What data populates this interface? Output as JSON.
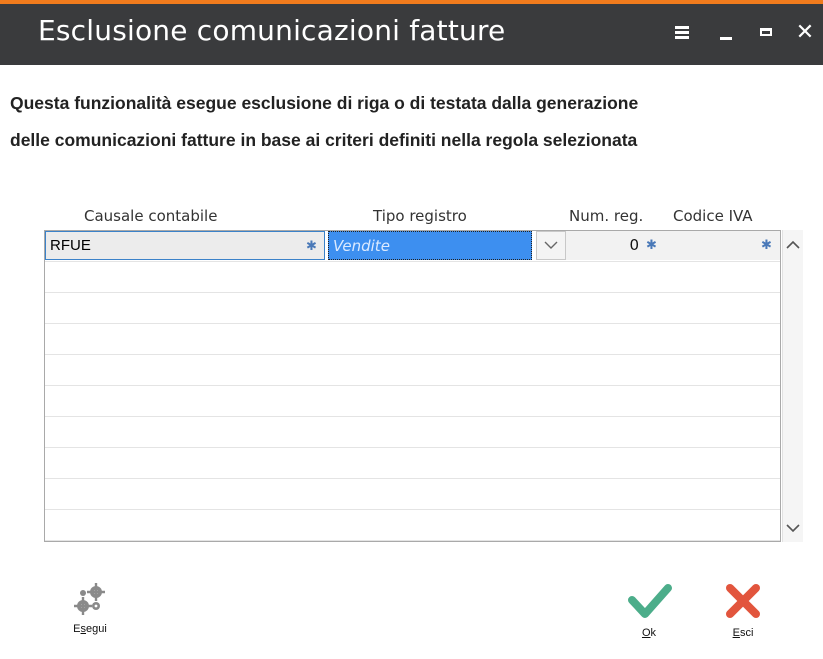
{
  "window": {
    "title": "Esclusione comunicazioni fatture"
  },
  "description": {
    "line1": "Questa funzionalità esegue esclusione di riga o di testata dalla generazione",
    "line2": "delle comunicazioni fatture in base ai criteri definiti nella regola selezionata"
  },
  "grid": {
    "columns": [
      "Causale contabile",
      "Tipo registro",
      "Num. reg.",
      "Codice IVA"
    ],
    "rows": [
      {
        "causale": "RFUE",
        "tipo_registro": "Vendite",
        "num_reg": "0",
        "codice_iva": ""
      }
    ],
    "empty_rows": 9
  },
  "buttons": {
    "esegui": {
      "pre": "E",
      "key": "s",
      "post": "egui"
    },
    "ok": {
      "pre": "",
      "key": "O",
      "post": "k"
    },
    "esci": {
      "pre": "",
      "key": "E",
      "post": "sci"
    }
  },
  "colors": {
    "accent": "#f07b1d",
    "titlebar": "#3a3b3d",
    "selection": "#3d8ff0",
    "ok_green": "#4cad8a",
    "esci_red": "#e2553d"
  }
}
